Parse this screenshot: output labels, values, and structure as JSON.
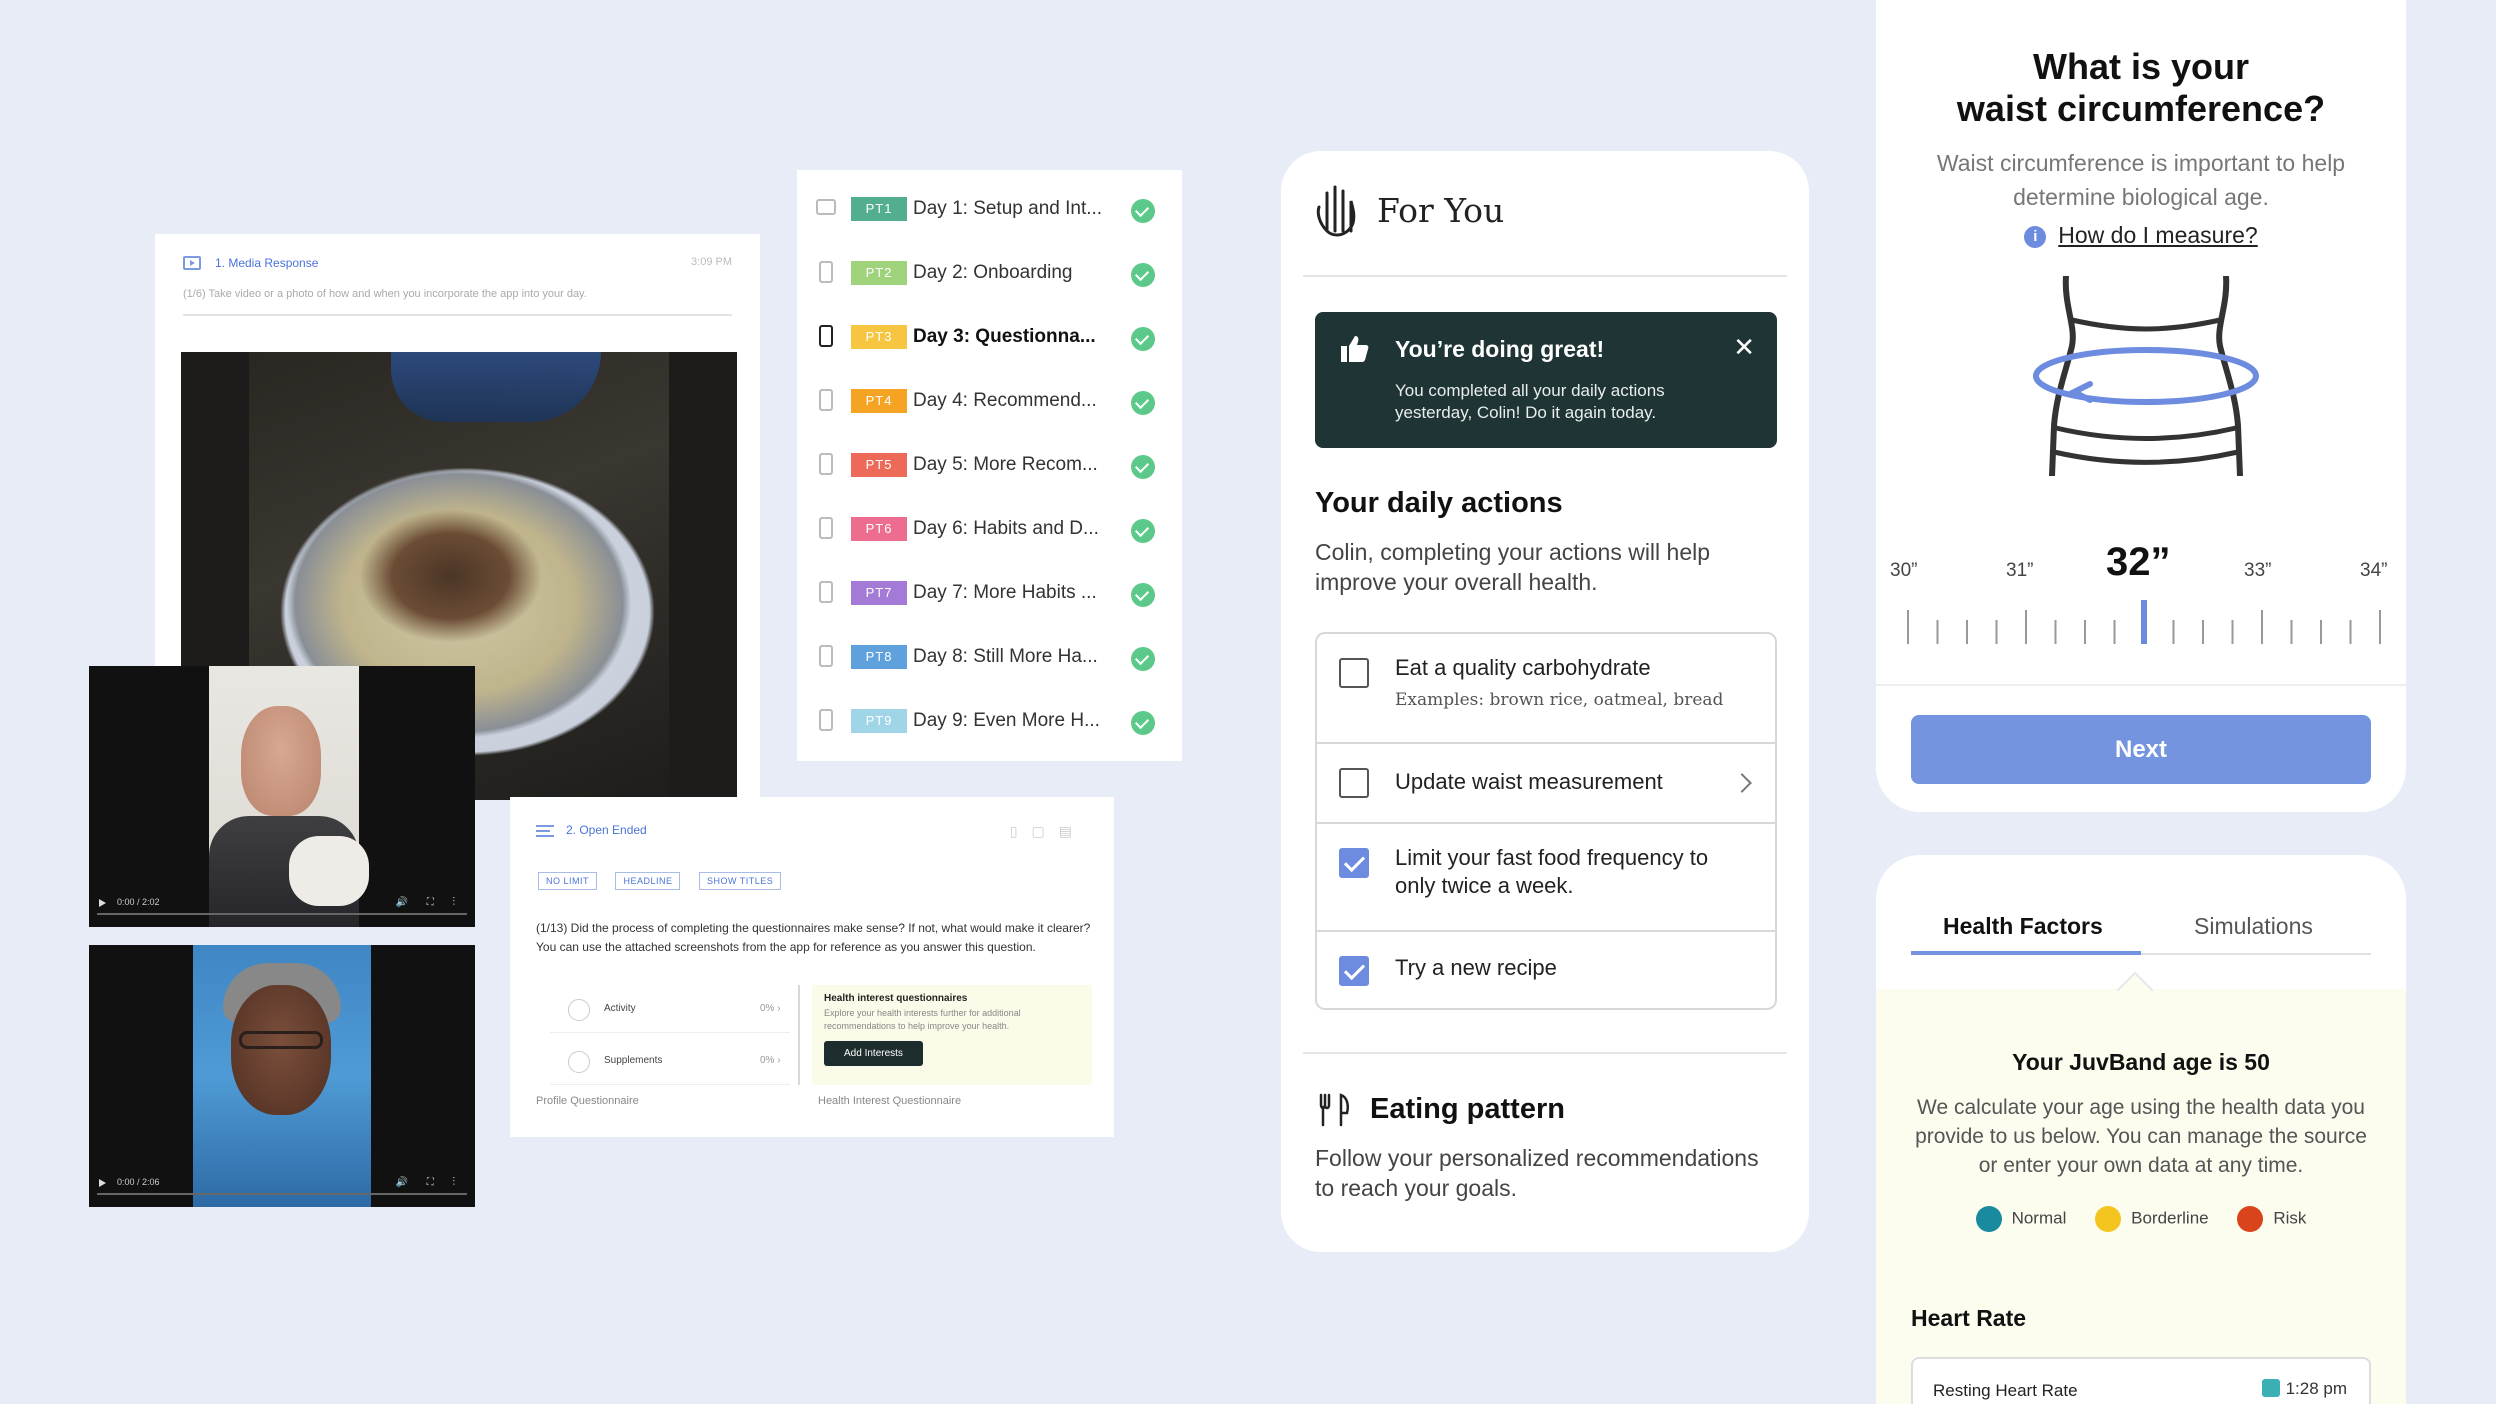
{
  "media_card": {
    "title": "1. Media Response",
    "time": "3:09 PM",
    "subtitle": "(1/6) Take video or a photo of how and when you incorporate the app into your day."
  },
  "videos": [
    {
      "time": "0:00 / 2:02",
      "controls": "🔊 ⛶ ⋮"
    },
    {
      "time": "0:00 / 2:06",
      "controls": "🔊 ⛶ ⋮"
    }
  ],
  "pt_list": [
    {
      "badge": "PT1",
      "label": "Day 1: Setup and Int...",
      "color": "#52ae8f",
      "device": "desktop"
    },
    {
      "badge": "PT2",
      "label": "Day 2: Onboarding",
      "color": "#9ed27b",
      "device": "phone"
    },
    {
      "badge": "PT3",
      "label": "Day 3: Questionna...",
      "color": "#f7c640",
      "device": "phone-active"
    },
    {
      "badge": "PT4",
      "label": "Day 4: Recommend...",
      "color": "#f5a322",
      "device": "phone"
    },
    {
      "badge": "PT5",
      "label": "Day 5: More Recom...",
      "color": "#ec6a57",
      "device": "phone"
    },
    {
      "badge": "PT6",
      "label": "Day 6: Habits and D...",
      "color": "#ec6d8e",
      "device": "phone"
    },
    {
      "badge": "PT7",
      "label": "Day 7: More Habits ...",
      "color": "#a37ad6",
      "device": "phone"
    },
    {
      "badge": "PT8",
      "label": "Day 8: Still More Ha...",
      "color": "#5ea1dd",
      "device": "phone"
    },
    {
      "badge": "PT9",
      "label": "Day 9: Even More H...",
      "color": "#9fd5e6",
      "device": "phone"
    }
  ],
  "open_card": {
    "title": "2. Open Ended",
    "chips": [
      "NO LIMIT",
      "HEADLINE",
      "SHOW TITLES"
    ],
    "question": "(1/13) Did the process of completing the questionnaires make sense? If not, what would make it clearer? You can use the attached screenshots from the app for reference as you answer this question.",
    "rows": [
      {
        "name": "Activity",
        "pct": "0%  ›"
      },
      {
        "name": "Supplements",
        "pct": "0%  ›"
      }
    ],
    "right_title": "Health interest questionnaires",
    "right_sub": "Explore your health interests further for additional recommendations to help improve your health.",
    "right_button": "Add Interests",
    "caption_left": "Profile Questionnaire",
    "caption_right": "Health Interest Questionnaire"
  },
  "for_you": {
    "title": "For You",
    "banner_title": "You’re doing great!",
    "banner_text": "You completed all your daily actions yesterday, Colin! Do it again today.",
    "banner_close": "✕",
    "daily_title": "Your daily actions",
    "daily_text": "Colin, completing your actions will help improve your overall health.",
    "actions": [
      {
        "label": "Eat a quality carbohydrate",
        "example": "Examples: brown rice, oatmeal, bread",
        "checked": false
      },
      {
        "label": "Update waist measurement",
        "checked": false
      },
      {
        "label": "Limit your fast food frequency to only twice a week.",
        "checked": true
      },
      {
        "label": "Try a new recipe",
        "checked": true
      }
    ],
    "eating_title": "Eating pattern",
    "eating_text": "Follow your personalized recommendations to reach your goals."
  },
  "waist": {
    "title_line1": "What is your",
    "title_line2": "waist circumference?",
    "subtitle": "Waist circumference is important to help determine biological age.",
    "how_link": "How do I measure?",
    "info_icon": "i",
    "scale": [
      "30”",
      "31”",
      "32”",
      "33”",
      "34”"
    ],
    "selected": "32”",
    "next": "Next",
    "accent": "#6d8ce0"
  },
  "health": {
    "tabs": [
      "Health Factors",
      "Simulations"
    ],
    "title": "Your JuvBand age is 50",
    "text": "We calculate your age using the health data you provide to us below. You can manage the source or enter your own data at any time.",
    "legend": [
      {
        "label": "Normal",
        "color": "#1a8a9e"
      },
      {
        "label": "Borderline",
        "color": "#f3c51e"
      },
      {
        "label": "Risk",
        "color": "#d9441d"
      }
    ],
    "heart_rate_title": "Heart Rate",
    "resting_label": "Resting Heart Rate",
    "resting_time": "1:28 pm"
  }
}
